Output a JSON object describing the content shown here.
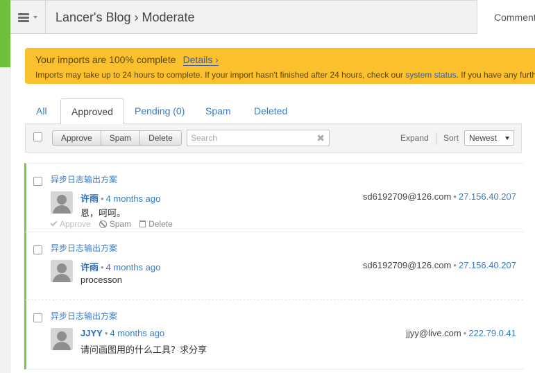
{
  "header": {
    "title": "Lancer's Blog › Moderate",
    "right_tab": "Comments"
  },
  "notice": {
    "headline": "Your imports are 100% complete",
    "details_link": "Details ›",
    "message_prefix": "Imports may take up to 24 hours to complete. If your import hasn't finished after 24 hours, check our",
    "status_link": "system status",
    "message_suffix": ". If you have any further questions"
  },
  "tabs": [
    {
      "label": "All"
    },
    {
      "label": "Approved"
    },
    {
      "label": "Pending (0)"
    },
    {
      "label": "Spam"
    },
    {
      "label": "Deleted"
    }
  ],
  "toolbar": {
    "approve": "Approve",
    "spam": "Spam",
    "delete": "Delete",
    "search_placeholder": "Search",
    "clear_glyph": "✖",
    "expand": "Expand",
    "sort_label": "Sort",
    "sort_value": "Newest"
  },
  "comments": [
    {
      "thread": "异步日志输出方案",
      "author": "许雨",
      "time": "4 months ago",
      "body": "恩，呵呵。",
      "email": "sd6192709@126.com",
      "ip": "27.156.40.207",
      "actions": {
        "approve": "Approve",
        "spam": "Spam",
        "delete": "Delete"
      }
    },
    {
      "thread": "异步日志输出方案",
      "author": "许雨",
      "time": "4 months ago",
      "body": "processon",
      "email": "sd6192709@126.com",
      "ip": "27.156.40.207"
    },
    {
      "thread": "异步日志输出方案",
      "author": "JJYY",
      "time": "4 months ago",
      "body": "请问画图用的什么工具？求分享",
      "email": "jjyy@live.com",
      "ip": "222.79.0.41"
    }
  ],
  "separator": "•"
}
